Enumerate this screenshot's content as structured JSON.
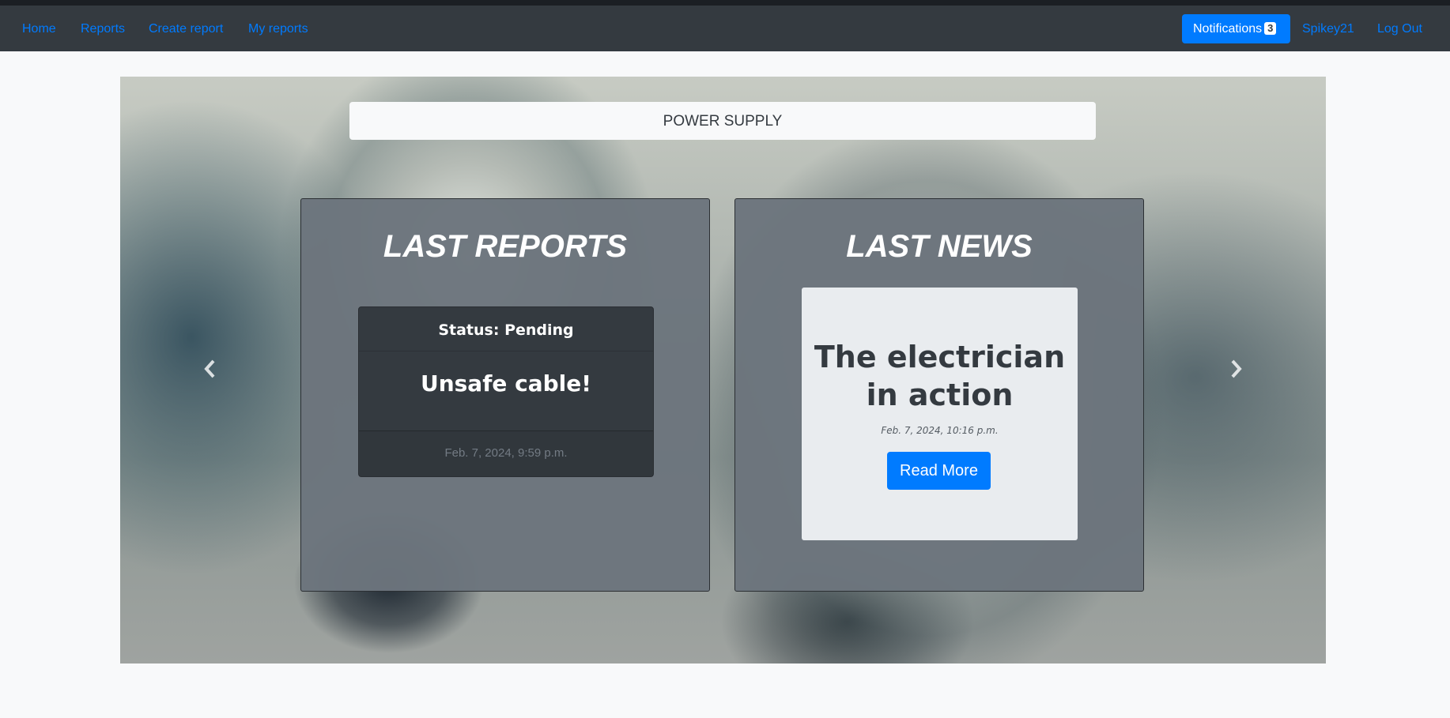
{
  "nav": {
    "left_links": [
      "Home",
      "Reports",
      "Create report",
      "My reports"
    ],
    "notifications_label": "Notifications",
    "notifications_count": "3",
    "username": "Spikey21",
    "logout_label": "Log Out"
  },
  "carousel": {
    "category_title": "POWER SUPPLY",
    "prev_icon": "chevron-left-icon",
    "next_icon": "chevron-right-icon"
  },
  "reports_panel": {
    "heading": "LAST REPORTS",
    "report": {
      "status": "Status: Pending",
      "title": "Unsafe cable!",
      "date": "Feb. 7, 2024, 9:59 p.m."
    }
  },
  "news_panel": {
    "heading": "LAST NEWS",
    "news": {
      "title_line1": "The electrician",
      "title_line2": "in action",
      "date": "Feb. 7, 2024, 10:16 p.m.",
      "button_label": "Read More"
    }
  },
  "colors": {
    "navbar": "#343a40",
    "link": "#007bff",
    "primary_button": "#007bff",
    "panel": "#6c757d",
    "report_card": "#343a40",
    "news_card": "#e9ecef"
  }
}
